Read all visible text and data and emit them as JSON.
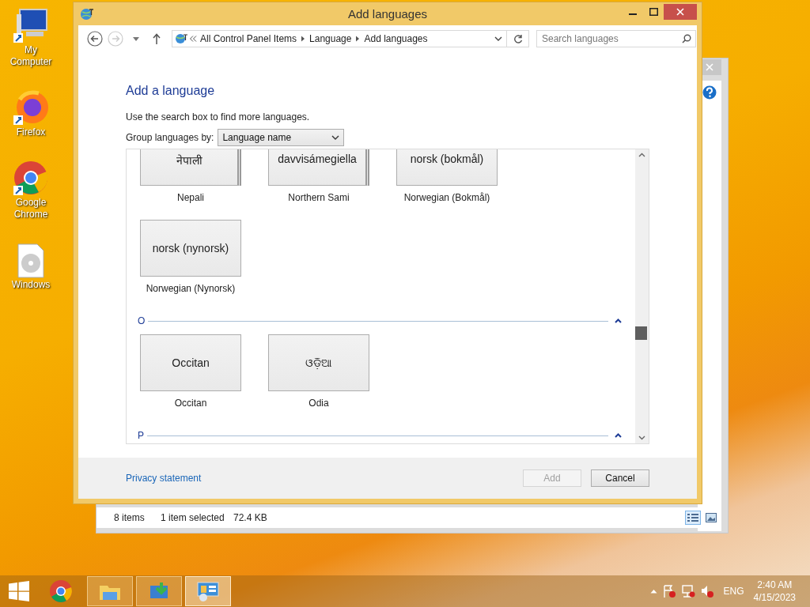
{
  "desktop_icons": [
    {
      "label": "My Computer",
      "kind": "computer"
    },
    {
      "label": "Firefox",
      "kind": "firefox"
    },
    {
      "label": "Google Chrome",
      "kind": "chrome"
    },
    {
      "label": "Windows",
      "kind": "disc"
    }
  ],
  "background_window": {
    "status_bar": {
      "count": "8 items",
      "selection": "1 item selected",
      "size": "72.4 KB"
    },
    "views": [
      {
        "kind": "details",
        "selected": true
      },
      {
        "kind": "tiles",
        "selected": false
      }
    ]
  },
  "window": {
    "title": "Add languages",
    "address": {
      "crumbs": [
        "All Control Panel Items",
        "Language",
        "Add languages"
      ]
    },
    "search": {
      "placeholder": "Search languages"
    },
    "heading": "Add a language",
    "hint": "Use the search box to find more languages.",
    "group_by": {
      "label": "Group languages by:",
      "value": "Language name"
    },
    "groups": [
      {
        "languages": [
          {
            "native": "नेपाली",
            "name": "Nepali",
            "stacked": true
          },
          {
            "native": "davvisámegiella",
            "name": "Northern Sami",
            "stacked": true
          },
          {
            "native": "norsk (bokmål)",
            "name": "Norwegian (Bokmål)",
            "stacked": false
          },
          {
            "native": "norsk (nynorsk)",
            "name": "Norwegian (Nynorsk)",
            "stacked": false
          }
        ]
      },
      {
        "letter": "O",
        "expanded": true,
        "languages": [
          {
            "native": "Occitan",
            "name": "Occitan",
            "stacked": false
          },
          {
            "native": "ଓଡ଼ିଆ",
            "name": "Odia",
            "stacked": false
          }
        ]
      },
      {
        "letter": "P",
        "expanded": true
      }
    ],
    "footer": {
      "link": "Privacy statement",
      "buttons": [
        {
          "label": "Add",
          "disabled": true
        },
        {
          "label": "Cancel",
          "disabled": false
        }
      ]
    }
  },
  "taskbar": {
    "apps": [
      {
        "kind": "chrome",
        "running": false,
        "selected": false
      },
      {
        "kind": "explorer",
        "running": true,
        "selected": false
      },
      {
        "kind": "installer",
        "running": true,
        "selected": false
      },
      {
        "kind": "control_panel",
        "running": true,
        "selected": true
      }
    ],
    "language": "ENG",
    "time": "2:40 AM",
    "date": "4/15/2023"
  }
}
